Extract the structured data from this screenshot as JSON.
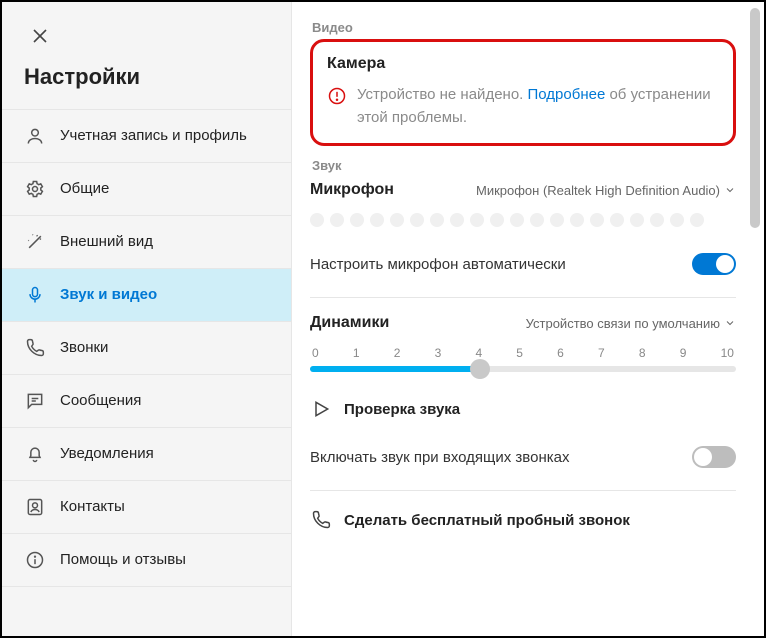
{
  "sidebar": {
    "title": "Настройки",
    "items": [
      {
        "label": "Учетная запись и профиль"
      },
      {
        "label": "Общие"
      },
      {
        "label": "Внешний вид"
      },
      {
        "label": "Звук и видео"
      },
      {
        "label": "Звонки"
      },
      {
        "label": "Сообщения"
      },
      {
        "label": "Уведомления"
      },
      {
        "label": "Контакты"
      },
      {
        "label": "Помощь и отзывы"
      }
    ],
    "active_index": 3
  },
  "video": {
    "section_label": "Видео",
    "camera_title": "Камера",
    "error_prefix": "Устройство не найдено. ",
    "error_link": "Подробнее",
    "error_suffix": " об устранении этой проблемы."
  },
  "sound": {
    "section_label": "Звук",
    "microphone": {
      "title": "Микрофон",
      "selected_device": "Микрофон (Realtek High Definition Audio)"
    },
    "auto_mic": {
      "label": "Настроить микрофон автоматически",
      "on": true
    },
    "speakers": {
      "title": "Динамики",
      "selected_device": "Устройство связи по умолчанию",
      "scale": [
        "0",
        "1",
        "2",
        "3",
        "4",
        "5",
        "6",
        "7",
        "8",
        "9",
        "10"
      ],
      "value": 4,
      "max": 10
    },
    "test_audio": "Проверка звука",
    "ring_on_incoming": {
      "label": "Включать звук при входящих звонках",
      "on": false
    },
    "test_call": "Сделать бесплатный пробный звонок"
  }
}
